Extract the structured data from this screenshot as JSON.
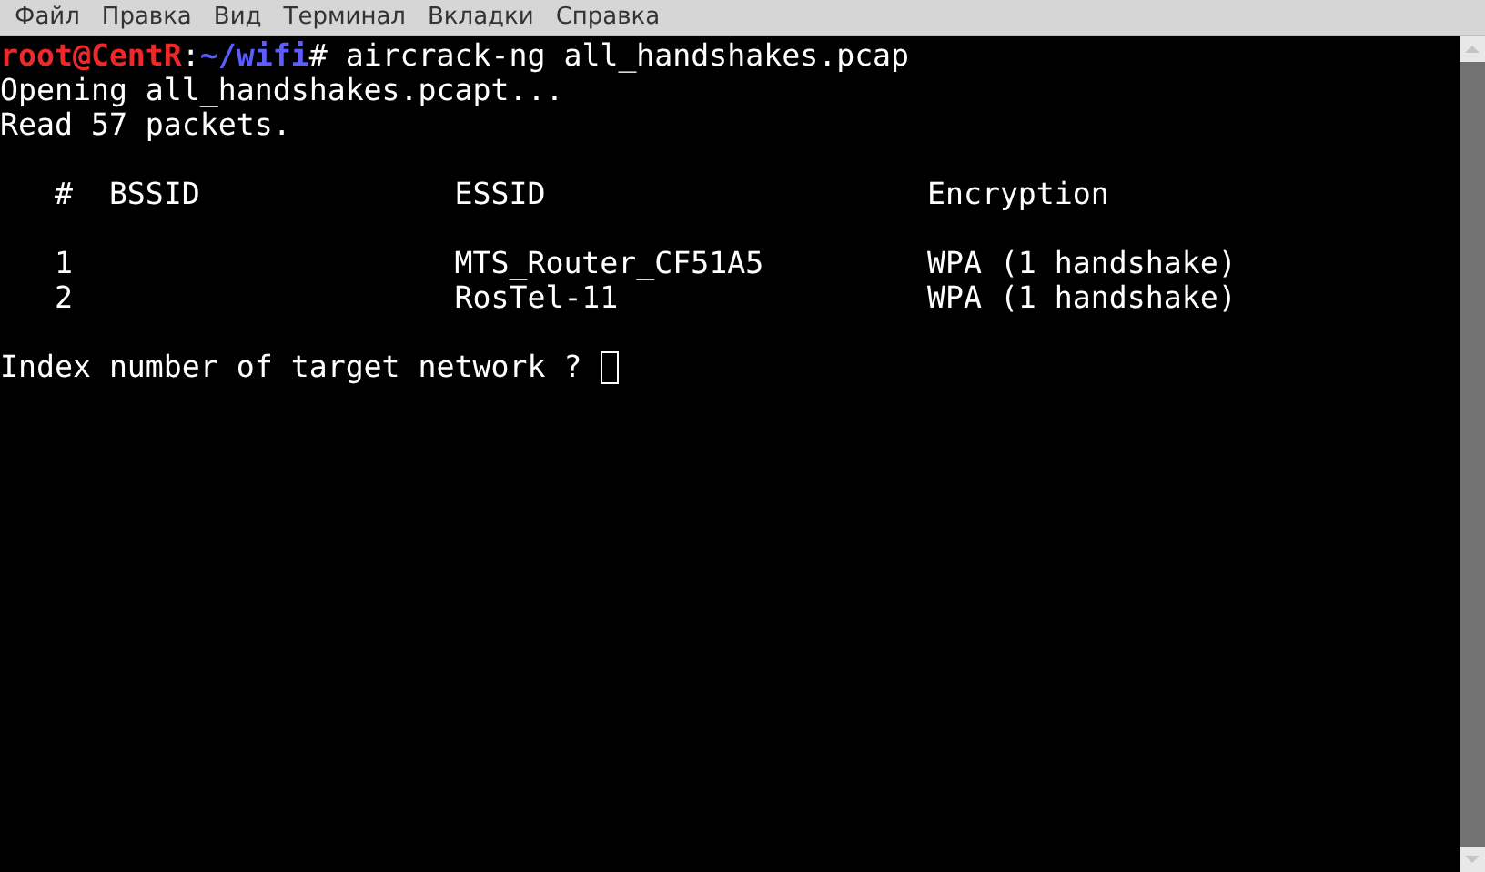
{
  "menu_bar": [
    "Файл",
    "Правка",
    "Вид",
    "Терминал",
    "Вкладки",
    "Справка"
  ],
  "terminal": {
    "prompt": {
      "user_host": "root@CentR",
      "separator": ":",
      "path": "~/wifi",
      "symbol": "#",
      "command": " aircrack-ng all_handshakes.pcap"
    },
    "output_lines": [
      "Opening all_handshakes.pcapt...",
      "Read 57 packets."
    ],
    "table": {
      "columns": [
        "#",
        "BSSID",
        "ESSID",
        "Encryption"
      ],
      "rows": [
        {
          "index": "1",
          "essid": "MTS_Router_CF51A5",
          "encryption": "WPA (1 handshake)"
        },
        {
          "index": "2",
          "essid": "RosTel-11",
          "encryption": "WPA (1 handshake)"
        }
      ]
    },
    "question": "Index number of target network ?"
  }
}
